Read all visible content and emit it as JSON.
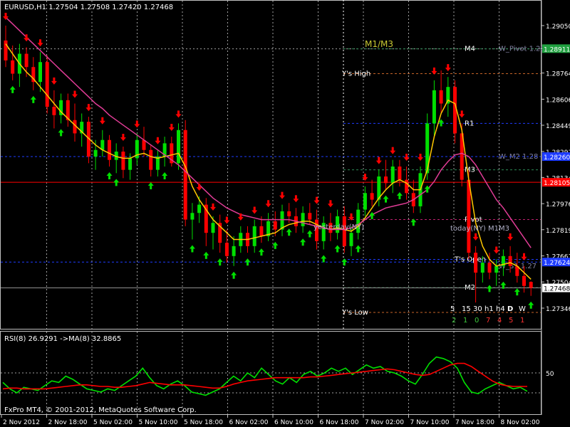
{
  "chart_data": [
    {
      "type": "candlestick",
      "title": "EURUSD,H1  1.27504 1.27508 1.27420 1.27468",
      "symbol": "EURUSD",
      "timeframe": "H1",
      "ohlc_last": {
        "open": 1.27504,
        "high": 1.27508,
        "low": 1.2742,
        "close": 1.27468
      },
      "ylim": [
        1.2723,
        1.2917
      ],
      "price_ticks": [
        "1.29050",
        "1.28911",
        "1.28764",
        "1.28606",
        "1.28449",
        "1.28291",
        "1.28134",
        "1.27976",
        "1.27819",
        "1.27661",
        "1.27504",
        "1.27346"
      ],
      "time_ticks": [
        "2 Nov 2012",
        "2 Nov 18:00",
        "5 Nov 02:00",
        "5 Nov 10:00",
        "5 Nov 18:00",
        "6 Nov 02:00",
        "6 Nov 10:00",
        "6 Nov 18:00",
        "7 Nov 02:00",
        "7 Nov 10:00",
        "7 Nov 18:00",
        "8 Nov 02:00"
      ],
      "current_price": "1.27468",
      "red_price_label": "1.28105",
      "blue_price_labels": [
        "1.28260",
        "1.27624"
      ],
      "green_price_label": "1.28911",
      "level_lines": [
        {
          "label": "M4",
          "price": 1.2891,
          "color": "#2e8b57"
        },
        {
          "label": "Y's High",
          "price": 1.2876,
          "color": "#c86428"
        },
        {
          "label": "R1",
          "price": 1.2846,
          "color": "#1e3cff"
        },
        {
          "label": "M3",
          "price": 1.2818,
          "color": "#2e8b57"
        },
        {
          "label": "Pivot",
          "price": 1.2788,
          "color": "#c02070"
        },
        {
          "label": "T's Open",
          "price": 1.2764,
          "color": "#1e3cff"
        },
        {
          "label": "M2",
          "price": 1.2747,
          "color": "#2e8b57"
        },
        {
          "label": "Y's Low",
          "price": 1.2732,
          "color": "#c86428"
        }
      ],
      "horizontal_lines": [
        {
          "price": 1.2826,
          "color": "#1e3cff",
          "style": "dash"
        },
        {
          "price": 1.28105,
          "color": "#ff0000",
          "style": "solid"
        },
        {
          "price": 1.27624,
          "color": "#1e3cff",
          "style": "dash"
        },
        {
          "price": 1.27468,
          "color": "#909090",
          "style": "solid"
        }
      ],
      "right_labels": [
        {
          "text": "W_Pivot 1.28",
          "price": 1.2891
        },
        {
          "text": "W_M2 1.28",
          "price": 1.2826
        },
        {
          "text": "W_S1 1.27",
          "price": 1.276
        }
      ],
      "annotations": [
        {
          "text": "M1/M3",
          "color": "#c8c832"
        },
        {
          "text": "yesterday(NY)",
          "color": "#b0b0c8"
        },
        {
          "text": "today(NY) M1M3",
          "color": "#b0b0c8"
        }
      ],
      "timeframe_labels": [
        "5",
        "15",
        "30",
        "h1",
        "h4",
        "D",
        "W"
      ],
      "timeframe_signals": [
        "2",
        "1",
        "0",
        "7",
        "4",
        "5",
        "1"
      ],
      "timeframe_signal_colors": [
        "#3cc83c",
        "#3cc83c",
        "#3cc83c",
        "#ff3030",
        "#ff3030",
        "#ff3030",
        "#ff3030"
      ],
      "series": [
        {
          "name": "candles",
          "up_color": "#00e000",
          "down_color": "#ff0000",
          "candles": [
            [
              1.2896,
              1.2905,
              1.288,
              1.2884
            ],
            [
              1.2884,
              1.2893,
              1.2872,
              1.2876
            ],
            [
              1.2876,
              1.2894,
              1.2868,
              1.2888
            ],
            [
              1.2888,
              1.2892,
              1.2874,
              1.288
            ],
            [
              1.288,
              1.2886,
              1.2866,
              1.2871
            ],
            [
              1.2871,
              1.2889,
              1.2865,
              1.2883
            ],
            [
              1.2883,
              1.2887,
              1.2852,
              1.2856
            ],
            [
              1.2856,
              1.2866,
              1.2843,
              1.2851
            ],
            [
              1.2851,
              1.2864,
              1.2846,
              1.286
            ],
            [
              1.286,
              1.2864,
              1.2844,
              1.2848
            ],
            [
              1.2848,
              1.2858,
              1.2835,
              1.284
            ],
            [
              1.284,
              1.2852,
              1.2832,
              1.2847
            ],
            [
              1.2847,
              1.285,
              1.2822,
              1.2826
            ],
            [
              1.2826,
              1.2836,
              1.2818,
              1.283
            ],
            [
              1.283,
              1.2842,
              1.2826,
              1.2836
            ],
            [
              1.2836,
              1.2839,
              1.282,
              1.2824
            ],
            [
              1.2824,
              1.2834,
              1.2816,
              1.2829
            ],
            [
              1.2829,
              1.2832,
              1.2813,
              1.2818
            ],
            [
              1.2818,
              1.2828,
              1.2812,
              1.2825
            ],
            [
              1.2825,
              1.284,
              1.2821,
              1.2836
            ],
            [
              1.2836,
              1.2844,
              1.2826,
              1.283
            ],
            [
              1.283,
              1.2833,
              1.2814,
              1.2818
            ],
            [
              1.2818,
              1.283,
              1.2814,
              1.2826
            ],
            [
              1.2826,
              1.2838,
              1.282,
              1.2834
            ],
            [
              1.2834,
              1.2838,
              1.282,
              1.2822
            ],
            [
              1.2822,
              1.2846,
              1.2818,
              1.2842
            ],
            [
              1.2842,
              1.2848,
              1.2784,
              1.2788
            ],
            [
              1.2788,
              1.2798,
              1.2776,
              1.2792
            ],
            [
              1.2792,
              1.2802,
              1.2786,
              1.2797
            ],
            [
              1.2797,
              1.2801,
              1.2772,
              1.278
            ],
            [
              1.278,
              1.279,
              1.277,
              1.2786
            ],
            [
              1.2786,
              1.2791,
              1.2768,
              1.2774
            ],
            [
              1.2774,
              1.2782,
              1.2762,
              1.2766
            ],
            [
              1.2766,
              1.2778,
              1.276,
              1.2772
            ],
            [
              1.2772,
              1.2784,
              1.2768,
              1.278
            ],
            [
              1.278,
              1.2784,
              1.2768,
              1.2772
            ],
            [
              1.2772,
              1.2788,
              1.2768,
              1.2784
            ],
            [
              1.2784,
              1.279,
              1.2774,
              1.2778
            ],
            [
              1.2778,
              1.2792,
              1.2775,
              1.2787
            ],
            [
              1.2787,
              1.2793,
              1.2778,
              1.2782
            ],
            [
              1.2782,
              1.2797,
              1.2778,
              1.2793
            ],
            [
              1.2793,
              1.2798,
              1.2786,
              1.279
            ],
            [
              1.279,
              1.2795,
              1.278,
              1.2784
            ],
            [
              1.2784,
              1.2796,
              1.278,
              1.2792
            ],
            [
              1.2792,
              1.2798,
              1.2785,
              1.2788
            ],
            [
              1.2788,
              1.2794,
              1.277,
              1.2775
            ],
            [
              1.2775,
              1.279,
              1.277,
              1.2786
            ],
            [
              1.2786,
              1.2792,
              1.2775,
              1.278
            ],
            [
              1.278,
              1.2794,
              1.2776,
              1.279
            ],
            [
              1.279,
              1.2796,
              1.2768,
              1.2772
            ],
            [
              1.2772,
              1.2784,
              1.2766,
              1.278
            ],
            [
              1.278,
              1.2798,
              1.2776,
              1.2794
            ],
            [
              1.2794,
              1.2808,
              1.279,
              1.2804
            ],
            [
              1.2804,
              1.2812,
              1.2796,
              1.28
            ],
            [
              1.28,
              1.2818,
              1.2796,
              1.2814
            ],
            [
              1.2814,
              1.2824,
              1.2806,
              1.281
            ],
            [
              1.281,
              1.2824,
              1.2804,
              1.282
            ],
            [
              1.282,
              1.2824,
              1.2808,
              1.2812
            ],
            [
              1.2812,
              1.282,
              1.28,
              1.2804
            ],
            [
              1.2804,
              1.2812,
              1.2792,
              1.2796
            ],
            [
              1.2796,
              1.282,
              1.2792,
              1.2816
            ],
            [
              1.2816,
              1.2852,
              1.2812,
              1.2846
            ],
            [
              1.2846,
              1.2872,
              1.2838,
              1.2866
            ],
            [
              1.2866,
              1.2878,
              1.2852,
              1.2858
            ],
            [
              1.2858,
              1.2874,
              1.285,
              1.2868
            ],
            [
              1.2868,
              1.2872,
              1.2834,
              1.284
            ],
            [
              1.284,
              1.2846,
              1.2808,
              1.2812
            ],
            [
              1.2812,
              1.2818,
              1.2764,
              1.2768
            ],
            [
              1.2768,
              1.2772,
              1.2738,
              1.2756
            ],
            [
              1.2756,
              1.2766,
              1.275,
              1.2762
            ],
            [
              1.2762,
              1.2768,
              1.2752,
              1.2756
            ],
            [
              1.2756,
              1.2764,
              1.2748,
              1.276
            ],
            [
              1.276,
              1.277,
              1.2754,
              1.2766
            ],
            [
              1.2766,
              1.2772,
              1.2756,
              1.276
            ],
            [
              1.276,
              1.2768,
              1.275,
              1.2754
            ],
            [
              1.2754,
              1.276,
              1.2744,
              1.2748
            ],
            [
              1.27504,
              1.27508,
              1.2742,
              1.27468
            ]
          ]
        },
        {
          "name": "fast MA",
          "color": "#ffc800",
          "values": [
            1.2894,
            1.2888,
            1.2882,
            1.2877,
            1.2873,
            1.2868,
            1.2863,
            1.2858,
            1.2853,
            1.2849,
            1.2845,
            1.2841,
            1.2837,
            1.2833,
            1.283,
            1.2828,
            1.2826,
            1.2825,
            1.2825,
            1.2827,
            1.2828,
            1.2826,
            1.2825,
            1.2826,
            1.2827,
            1.2828,
            1.282,
            1.2808,
            1.28,
            1.2794,
            1.2788,
            1.2784,
            1.278,
            1.2776,
            1.2776,
            1.2776,
            1.2777,
            1.2778,
            1.2779,
            1.278,
            1.2783,
            1.2785,
            1.2786,
            1.2787,
            1.2787,
            1.2785,
            1.2783,
            1.2782,
            1.2783,
            1.2782,
            1.2781,
            1.2784,
            1.2789,
            1.2795,
            1.2801,
            1.2806,
            1.281,
            1.2812,
            1.281,
            1.2806,
            1.2806,
            1.2818,
            1.2838,
            1.2852,
            1.286,
            1.2858,
            1.2842,
            1.2812,
            1.2786,
            1.2772,
            1.2764,
            1.276,
            1.2761,
            1.2762,
            1.276,
            1.2756,
            1.2752
          ]
        },
        {
          "name": "slow MA",
          "color": "#e03c96",
          "values": [
            1.291,
            1.2906,
            1.2902,
            1.2898,
            1.2894,
            1.289,
            1.2886,
            1.2882,
            1.2878,
            1.2874,
            1.287,
            1.2866,
            1.2862,
            1.2858,
            1.2855,
            1.2851,
            1.2848,
            1.2845,
            1.2842,
            1.2839,
            1.2836,
            1.2833,
            1.283,
            1.2827,
            1.2824,
            1.2821,
            1.2817,
            1.2813,
            1.2809,
            1.2805,
            1.2801,
            1.2798,
            1.2795,
            1.2793,
            1.2791,
            1.279,
            1.2789,
            1.2788,
            1.2788,
            1.2788,
            1.2788,
            1.2788,
            1.2787,
            1.2786,
            1.2785,
            1.2784,
            1.2783,
            1.2782,
            1.2782,
            1.2782,
            1.2783,
            1.2785,
            1.2788,
            1.2791,
            1.2793,
            1.2795,
            1.2796,
            1.2797,
            1.2798,
            1.28,
            1.2803,
            1.2806,
            1.2811,
            1.2818,
            1.2823,
            1.2827,
            1.2828,
            1.2826,
            1.2821,
            1.2814,
            1.2807,
            1.28,
            1.2795,
            1.2789,
            1.2783,
            1.2777,
            1.2771
          ]
        }
      ],
      "up_arrows": [
        1,
        4,
        8,
        15,
        16,
        21,
        23,
        27,
        29,
        31,
        33,
        35,
        37,
        39,
        41,
        43,
        44,
        46,
        48,
        49,
        51,
        53,
        55,
        57,
        59,
        61,
        63,
        70,
        72,
        74,
        76
      ],
      "down_arrows": [
        0,
        3,
        5,
        7,
        10,
        12,
        14,
        17,
        19,
        22,
        24,
        25,
        28,
        30,
        32,
        34,
        36,
        38,
        40,
        42,
        45,
        47,
        50,
        52,
        54,
        56,
        58,
        60,
        62,
        64,
        66,
        68,
        71,
        73,
        75
      ],
      "footer": "FxPro MT4, © 2001-2012, MetaQuotes Software Corp."
    },
    {
      "type": "line",
      "title": "RSI(8) 26.9291  ->MA(8) 32.8865",
      "ylim": [
        0,
        100
      ],
      "y_ticks": [
        "50"
      ],
      "levels": [
        50,
        25
      ],
      "series": [
        {
          "name": "RSI(8)",
          "color": "#00e000",
          "values": [
            38,
            30,
            25,
            32,
            30,
            28,
            34,
            40,
            38,
            46,
            42,
            36,
            30,
            28,
            26,
            30,
            28,
            34,
            40,
            46,
            56,
            44,
            34,
            30,
            36,
            40,
            34,
            26,
            24,
            22,
            26,
            30,
            38,
            46,
            40,
            50,
            44,
            56,
            48,
            40,
            36,
            44,
            38,
            48,
            52,
            46,
            50,
            56,
            52,
            56,
            48,
            54,
            60,
            56,
            58,
            52,
            50,
            46,
            40,
            36,
            48,
            62,
            70,
            68,
            64,
            56,
            38,
            26,
            24,
            30,
            34,
            38,
            34,
            30,
            32,
            27
          ]
        },
        {
          "name": "MA(8)",
          "color": "#ff0000",
          "values": [
            30,
            31,
            31,
            30,
            30,
            30,
            30,
            31,
            32,
            33,
            34,
            35,
            35,
            34,
            33,
            33,
            32,
            32,
            33,
            34,
            36,
            38,
            37,
            36,
            35,
            35,
            35,
            34,
            33,
            32,
            31,
            31,
            33,
            36,
            38,
            40,
            41,
            42,
            43,
            44,
            44,
            44,
            44,
            44,
            45,
            45,
            46,
            47,
            48,
            49,
            50,
            51,
            52,
            53,
            54,
            55,
            54,
            52,
            50,
            48,
            47,
            48,
            52,
            56,
            60,
            62,
            62,
            58,
            52,
            46,
            40,
            36,
            34,
            33,
            33,
            33
          ]
        }
      ]
    }
  ]
}
